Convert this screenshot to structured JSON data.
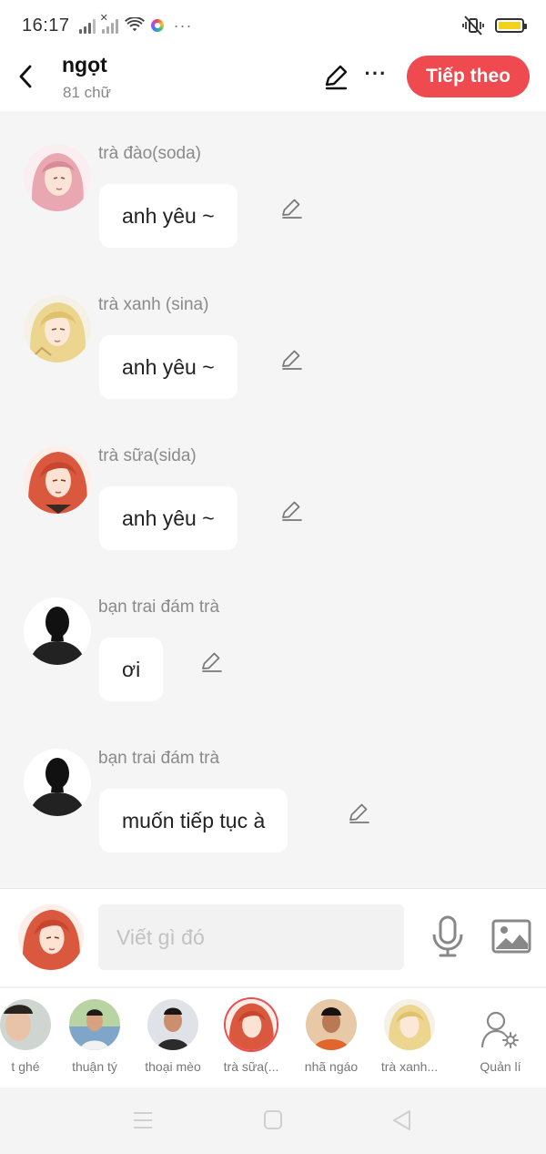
{
  "status_bar": {
    "time": "16:17",
    "battery_color": "#f2d21a",
    "icons": [
      "signal-icon",
      "signal-no-service-icon",
      "wifi-icon",
      "color-app-icon",
      "more-dots-icon",
      "vibrate-mode-icon",
      "battery-icon"
    ],
    "more": "···"
  },
  "header": {
    "title": "ngọt",
    "subtitle": "81 chữ",
    "more_label": "···",
    "next_label": "Tiếp theo",
    "accent_color": "#ef4a4f"
  },
  "messages": [
    {
      "sender": "trà đào(soda)",
      "text": "anh yêu ~",
      "avatar": "anime-girl-pink-avatar"
    },
    {
      "sender": "trà xanh (sina)",
      "text": "anh yêu ~",
      "avatar": "anime-girl-blonde-avatar"
    },
    {
      "sender": "trà sữa(sida)",
      "text": "anh yêu ~",
      "avatar": "anime-girl-redhair-avatar"
    },
    {
      "sender": "bạn trai đám trà",
      "text": "ơi",
      "avatar": "silhouette-avatar"
    },
    {
      "sender": "bạn trai đám trà",
      "text": "muốn tiếp tục à",
      "avatar": "silhouette-avatar"
    }
  ],
  "input": {
    "placeholder": "Viết gì đó"
  },
  "characters": [
    {
      "name": "t ghé"
    },
    {
      "name": "thuận tý"
    },
    {
      "name": "thoại mèo"
    },
    {
      "name": "trà sữa(...",
      "selected": true
    },
    {
      "name": "nhã ngáo"
    },
    {
      "name": "trà xanh..."
    }
  ],
  "manage_label": "Quản lí"
}
